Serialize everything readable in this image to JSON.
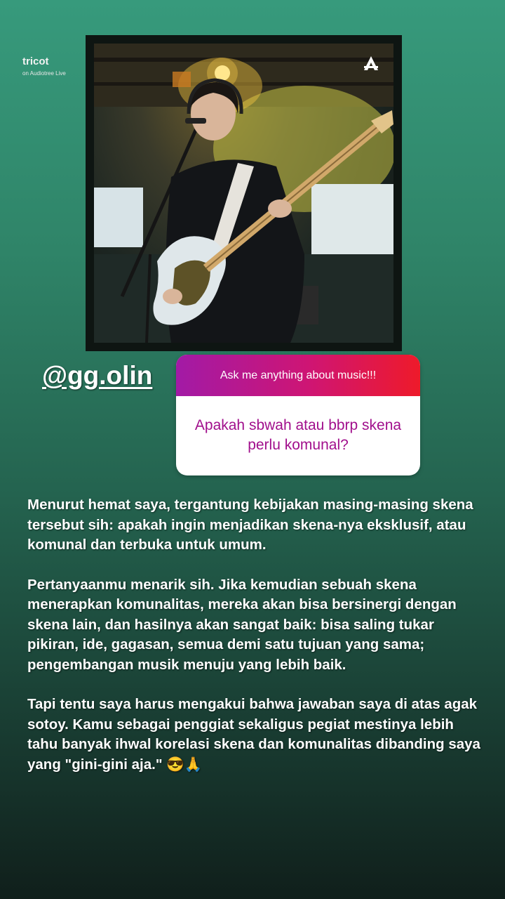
{
  "photo": {
    "title": "tricot",
    "subtitle": "on Audiotree Live",
    "logo_icon": "audiotree-logo-icon"
  },
  "username": "@gg.olin",
  "question_box": {
    "prompt": "Ask me anything about music!!!",
    "question": "Apakah sbwah atau bbrp skena perlu komunal?"
  },
  "answer": {
    "p1": "Menurut hemat saya, tergantung kebijakan masing-masing skena tersebut sih: apakah ingin menjadikan skena-nya eksklusif, atau komunal dan terbuka untuk umum.",
    "p2": "Pertanyaanmu menarik sih. Jika kemudian sebuah skena menerapkan komunalitas, mereka akan bisa bersinergi dengan skena lain, dan hasilnya akan sangat baik: bisa saling tukar pikiran, ide, gagasan, semua demi satu tujuan yang sama; pengembangan musik menuju yang lebih baik.",
    "p3": "Tapi tentu saya harus mengakui bahwa jawaban saya di atas agak sotoy. Kamu sebagai penggiat sekaligus pegiat mestinya lebih tahu banyak ihwal korelasi skena dan komunalitas dibanding saya yang \"gini-gini aja.\" 😎🙏"
  },
  "colors": {
    "question_text": "#a10f8c",
    "header_gradient_start": "#a21aa6",
    "header_gradient_end": "#ee1a2a"
  }
}
